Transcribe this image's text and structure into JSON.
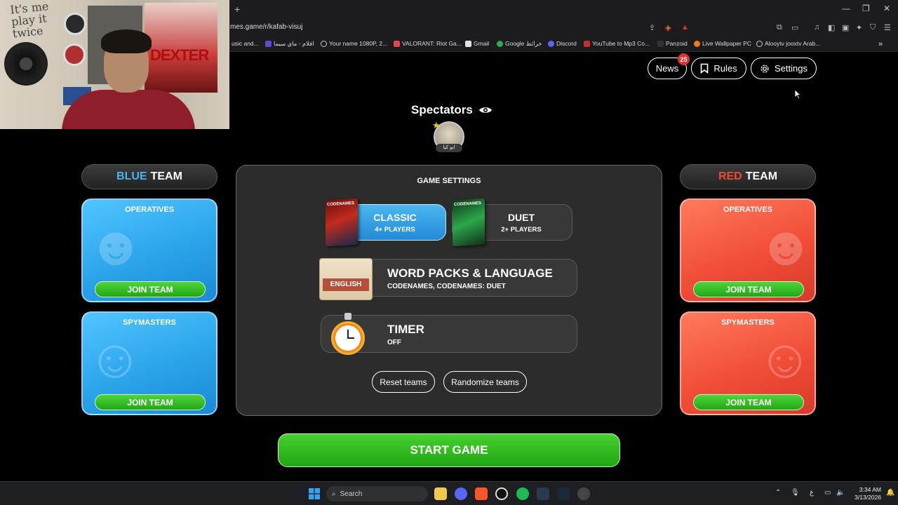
{
  "browser": {
    "new_tab": "+",
    "url": "mes.game/r/kafab-visuj",
    "bookmarks": [
      {
        "label": "usic and..."
      },
      {
        "label": "افلام - ماي سيما"
      },
      {
        "label": "Your name 1080P, 2..."
      },
      {
        "label": "VALORANT: Riot Ga..."
      },
      {
        "label": "Gmail"
      },
      {
        "label": "Google خرائط"
      },
      {
        "label": "Discord"
      },
      {
        "label": "YouTube to Mp3 Co..."
      },
      {
        "label": "Panzoid"
      },
      {
        "label": "Live Wallpaper PC"
      },
      {
        "label": "Alooytv jooxtv Arab..."
      }
    ]
  },
  "webcam": {
    "wall_text": "It's me play it twice",
    "poster_text": "DEXTER"
  },
  "nav": {
    "news_label": "News",
    "news_count": "25",
    "rules_label": "Rules",
    "settings_label": "Settings"
  },
  "spectators": {
    "title": "Spectators",
    "player_name": "ابو كيا"
  },
  "blue_team": {
    "color_word": "BLUE",
    "team_word": "TEAM",
    "operatives_title": "OPERATIVES",
    "spymasters_title": "SPYMASTERS",
    "join_label": "JOIN TEAM"
  },
  "red_team": {
    "color_word": "RED",
    "team_word": "TEAM",
    "operatives_title": "OPERATIVES",
    "spymasters_title": "SPYMASTERS",
    "join_label": "JOIN TEAM"
  },
  "game_settings": {
    "title": "GAME SETTINGS",
    "modes": [
      {
        "name": "CLASSIC",
        "players": "4+ PLAYERS",
        "box_text": "CODENAMES"
      },
      {
        "name": "DUET",
        "players": "2+ PLAYERS",
        "box_text": "CODENAMES"
      }
    ],
    "word_packs": {
      "label": "WORD PACKS & LANGUAGE",
      "value": "CODENAMES, CODENAMES: DUET",
      "language_tag": "ENGLISH"
    },
    "timer": {
      "label": "TIMER",
      "value": "OFF"
    },
    "reset_label": "Reset teams",
    "randomize_label": "Randomize teams"
  },
  "start_label": "START GAME",
  "taskbar": {
    "search_label": "Search",
    "lang": "ع",
    "time": "3:34 AM",
    "date": "3/13/2026"
  },
  "colors": {
    "blue": "#4ab4ec",
    "red": "#ef4c36",
    "green": "#2cb81c"
  }
}
